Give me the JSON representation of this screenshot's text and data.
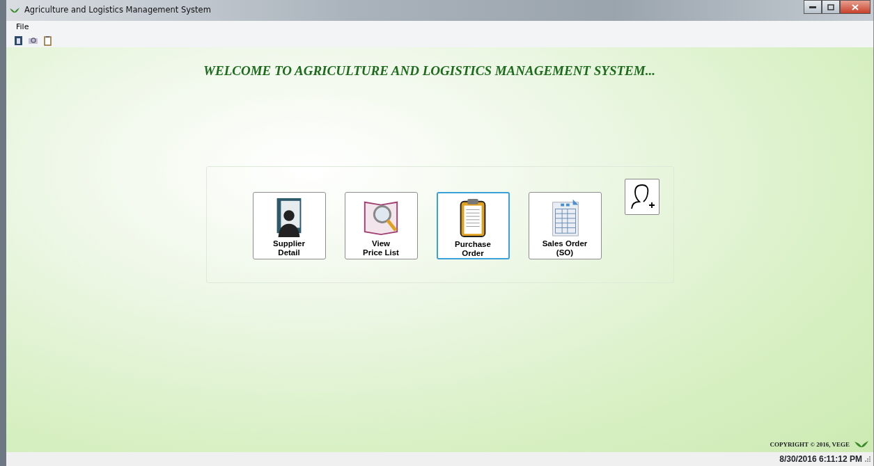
{
  "window": {
    "title": "Agriculture and Logistics Management System"
  },
  "menu": [
    "File"
  ],
  "toolbar": [
    {
      "kind": "book"
    },
    {
      "kind": "scan"
    },
    {
      "kind": "clipboard"
    }
  ],
  "heading": "WELCOME TO AGRICULTURE AND LOGISTICS MANAGEMENT SYSTEM...",
  "tiles": [
    {
      "kind": "supplier",
      "lines": [
        "Supplier",
        "Detail"
      ],
      "selected": false
    },
    {
      "kind": "pricelist",
      "lines": [
        "View",
        "Price List"
      ],
      "selected": false
    },
    {
      "kind": "purchase",
      "lines": [
        "Purchase",
        "Order"
      ],
      "selected": true
    },
    {
      "kind": "sales",
      "lines": [
        "Sales Order",
        "(SO)"
      ],
      "selected": false
    }
  ],
  "copyright": "COPYRIGHT © 2016, VEGE",
  "status_bar": {
    "datetime": "8/30/2016 6:11:12 PM"
  }
}
